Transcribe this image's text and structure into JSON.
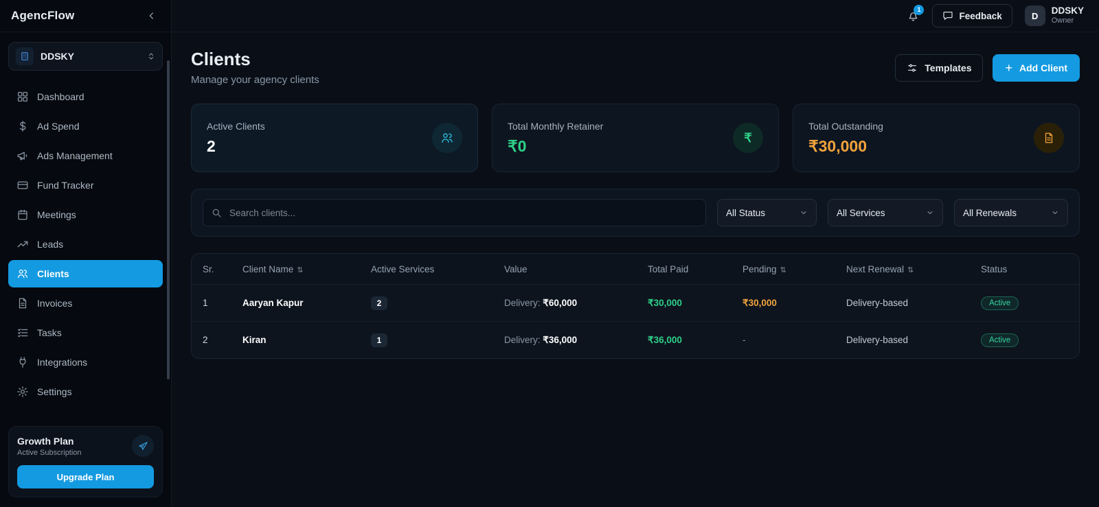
{
  "app": {
    "name": "AgencFlow"
  },
  "colors": {
    "accent_blue": "#149ae1",
    "money_green": "#2fd189",
    "money_orange": "#f2a33c",
    "status_active_green": "#33d69f",
    "background": "#0a0f17"
  },
  "sidebar": {
    "workspace": {
      "name": "DDSKY",
      "icon": "building-icon"
    },
    "items": [
      {
        "label": "Dashboard",
        "icon": "grid-icon"
      },
      {
        "label": "Ad Spend",
        "icon": "dollar-icon"
      },
      {
        "label": "Ads Management",
        "icon": "megaphone-icon"
      },
      {
        "label": "Fund Tracker",
        "icon": "wallet-icon"
      },
      {
        "label": "Meetings",
        "icon": "calendar-icon"
      },
      {
        "label": "Leads",
        "icon": "trend-up-icon"
      },
      {
        "label": "Clients",
        "icon": "users-icon",
        "active": true
      },
      {
        "label": "Invoices",
        "icon": "invoice-icon"
      },
      {
        "label": "Tasks",
        "icon": "tasks-icon"
      },
      {
        "label": "Integrations",
        "icon": "plug-icon"
      },
      {
        "label": "Settings",
        "icon": "gear-icon"
      }
    ],
    "plan": {
      "title": "Growth Plan",
      "subtitle": "Active Subscription",
      "cta": "Upgrade Plan",
      "icon": "rocket-icon"
    }
  },
  "header": {
    "notification_count": "1",
    "feedback_label": "Feedback",
    "user": {
      "initial": "D",
      "name": "DDSKY",
      "role": "Owner"
    }
  },
  "page": {
    "title": "Clients",
    "subtitle": "Manage your agency clients",
    "templates_label": "Templates",
    "add_client_label": "Add Client"
  },
  "stats": [
    {
      "label": "Active Clients",
      "value": "2",
      "icon": "users-icon",
      "value_color": "#ffffff"
    },
    {
      "label": "Total Monthly Retainer",
      "value": "₹0",
      "icon": "rupee-icon",
      "value_color": "#2fd189"
    },
    {
      "label": "Total Outstanding",
      "value": "₹30,000",
      "icon": "document-icon",
      "value_color": "#f2a33c"
    }
  ],
  "filters": {
    "search_placeholder": "Search clients...",
    "dropdowns": [
      "All Status",
      "All Services",
      "All Renewals"
    ]
  },
  "table": {
    "columns": [
      "Sr.",
      "Client Name",
      "Active Services",
      "Value",
      "Total Paid",
      "Pending",
      "Next Renewal",
      "Status"
    ],
    "sortable_columns": [
      "Client Name",
      "Pending",
      "Next Renewal"
    ],
    "rows": [
      {
        "sr": "1",
        "name": "Aaryan Kapur",
        "services": "2",
        "value_label": "Delivery:",
        "value": "₹60,000",
        "paid": "₹30,000",
        "pending": "₹30,000",
        "renewal": "Delivery-based",
        "status": "Active"
      },
      {
        "sr": "2",
        "name": "Kiran",
        "services": "1",
        "value_label": "Delivery:",
        "value": "₹36,000",
        "paid": "₹36,000",
        "pending": "-",
        "renewal": "Delivery-based",
        "status": "Active"
      }
    ]
  }
}
